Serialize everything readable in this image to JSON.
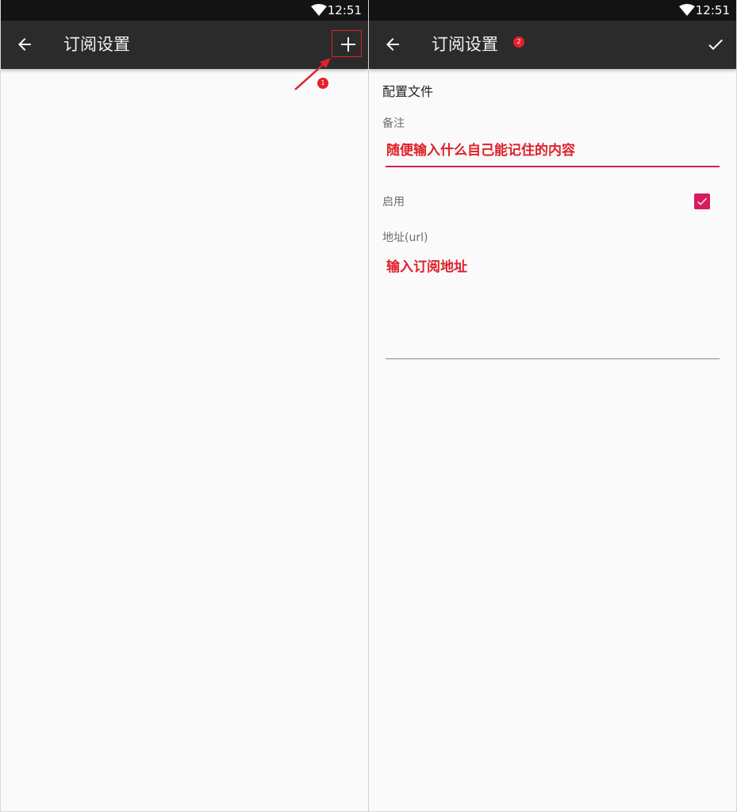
{
  "status_bar": {
    "time": "12:51"
  },
  "left_screen": {
    "title": "订阅设置",
    "annotation_badge": "1"
  },
  "right_screen": {
    "title": "订阅设置",
    "annotation_badge": "2",
    "section_title": "配置文件",
    "remark": {
      "label": "备注",
      "annotation_text": "随便输入什么自己能记住的内容"
    },
    "enable": {
      "label": "启用",
      "checked": true
    },
    "url": {
      "label": "地址(url)",
      "annotation_text": "输入订阅地址"
    }
  },
  "colors": {
    "toolbar": "#2b2b2b",
    "status_bar": "#131313",
    "accent": "#d81b60",
    "annotation_red": "#e0202a"
  }
}
